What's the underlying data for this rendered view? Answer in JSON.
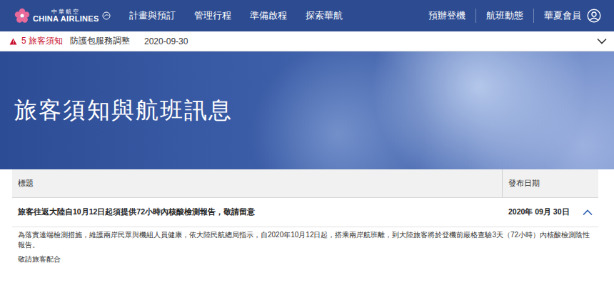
{
  "header": {
    "logo": {
      "chinese": "中華航空",
      "english": "CHINA AIRLINES"
    },
    "nav": [
      "計畫與預訂",
      "管理行程",
      "準備啟程",
      "探索華航"
    ],
    "utility": [
      "預辦登機",
      "航班動態"
    ],
    "member": "華夏會員"
  },
  "notice_bar": {
    "count": "5",
    "label": "旅客須知",
    "headline": "防護包服務調整",
    "date": "2020-09-30",
    "expanded": false
  },
  "hero": {
    "title": "旅客須知與航班訊息"
  },
  "table": {
    "columns": [
      "標題",
      "發布日期"
    ],
    "rows": [
      {
        "title": "旅客往返大陸自10月12日起須提供72小時內核酸檢測報告，敬請留意",
        "date": "2020年 09月 30日",
        "expanded": true,
        "body": [
          "為落實遠端檢測措施，維護兩岸民眾與機組人員健康，依大陸民航總局指示，自2020年10月12日起，搭乘兩岸航班離，到大陸旅客將於登機前嚴格查驗3天（72小時）內核酸檢測陰性報告。",
          "敬請旅客配合"
        ]
      }
    ]
  }
}
